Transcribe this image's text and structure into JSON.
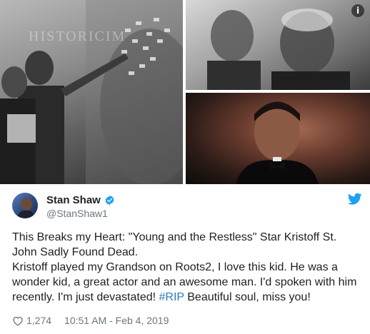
{
  "media": {
    "watermark": "HISTORICIM",
    "info_icon": "info-icon",
    "info_glyph": "i"
  },
  "author": {
    "display_name": "Stan Shaw",
    "handle": "@StanShaw1",
    "verified_icon": "verified-badge-icon",
    "brand_icon": "twitter-bird-icon"
  },
  "tweet": {
    "line1": "This Breaks my Heart: \"Young and the Restless\" Star Kristoff St. John Sadly Found Dead.",
    "line2_before": "Kristoff played my Grandson on Roots2, I love this kid. He was a wonder kid, a great actor and an awesome man. I'd spoken with him recently. I'm just devastated! ",
    "hashtag": "#RIP",
    "line2_after": " Beautiful soul, miss you!"
  },
  "meta": {
    "like_count": "1,274",
    "timestamp": "10:51 AM - Feb 4, 2019",
    "heart_icon": "heart-icon"
  },
  "colors": {
    "link": "#2b7bb9",
    "brand": "#1da1f2",
    "muted": "#697882",
    "text": "#1c2022"
  }
}
